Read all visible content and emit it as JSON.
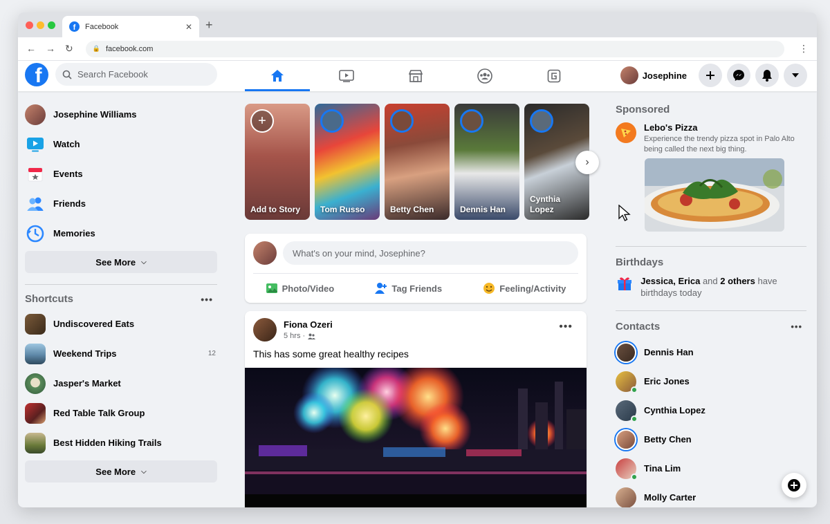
{
  "browser": {
    "tab_title": "Facebook",
    "url": "facebook.com"
  },
  "header": {
    "search_placeholder": "Search Facebook",
    "nav_tabs": [
      "home-icon",
      "watch-icon",
      "marketplace-icon",
      "groups-icon",
      "gaming-icon"
    ],
    "profile_name": "Josephine"
  },
  "left": {
    "items": [
      {
        "label": "Josephine Williams",
        "icon": "avatar"
      },
      {
        "label": "Watch",
        "icon": "watch-icon"
      },
      {
        "label": "Events",
        "icon": "calendar-icon"
      },
      {
        "label": "Friends",
        "icon": "friends-icon"
      },
      {
        "label": "Memories",
        "icon": "clock-icon"
      }
    ],
    "see_more": "See More",
    "shortcuts_title": "Shortcuts",
    "shortcuts": [
      {
        "label": "Undiscovered Eats",
        "count": ""
      },
      {
        "label": "Weekend Trips",
        "count": "12"
      },
      {
        "label": "Jasper's Market",
        "count": ""
      },
      {
        "label": "Red Table Talk Group",
        "count": ""
      },
      {
        "label": "Best Hidden Hiking Trails",
        "count": ""
      }
    ],
    "see_more_2": "See More"
  },
  "stories": [
    {
      "name": "Add to Story"
    },
    {
      "name": "Tom Russo"
    },
    {
      "name": "Betty Chen"
    },
    {
      "name": "Dennis Han"
    },
    {
      "name": "Cynthia Lopez"
    }
  ],
  "composer": {
    "placeholder": "What's on your mind, Josephine?",
    "photo": "Photo/Video",
    "tag": "Tag Friends",
    "feeling": "Feeling/Activity"
  },
  "post": {
    "author": "Fiona Ozeri",
    "time": "5 hrs ·",
    "text": "This has some great healthy recipes"
  },
  "right": {
    "sponsored_title": "Sponsored",
    "ad_name": "Lebo's Pizza",
    "ad_desc": "Experience the trendy pizza spot in Palo Alto being called the next big thing.",
    "birthdays_title": "Birthdays",
    "bday_names": "Jessica, Erica",
    "bday_and": "and",
    "bday_others": "2 others",
    "bday_rest": "have birthdays today",
    "contacts_title": "Contacts",
    "contacts": [
      {
        "name": "Dennis Han",
        "online": false,
        "story": true
      },
      {
        "name": "Eric Jones",
        "online": true,
        "story": false
      },
      {
        "name": "Cynthia Lopez",
        "online": true,
        "story": false
      },
      {
        "name": "Betty Chen",
        "online": false,
        "story": true
      },
      {
        "name": "Tina Lim",
        "online": true,
        "story": false
      },
      {
        "name": "Molly Carter",
        "online": false,
        "story": false
      }
    ]
  },
  "colors": {
    "brand": "#1877f2",
    "online": "#31a24c",
    "background": "#f0f2f5"
  }
}
